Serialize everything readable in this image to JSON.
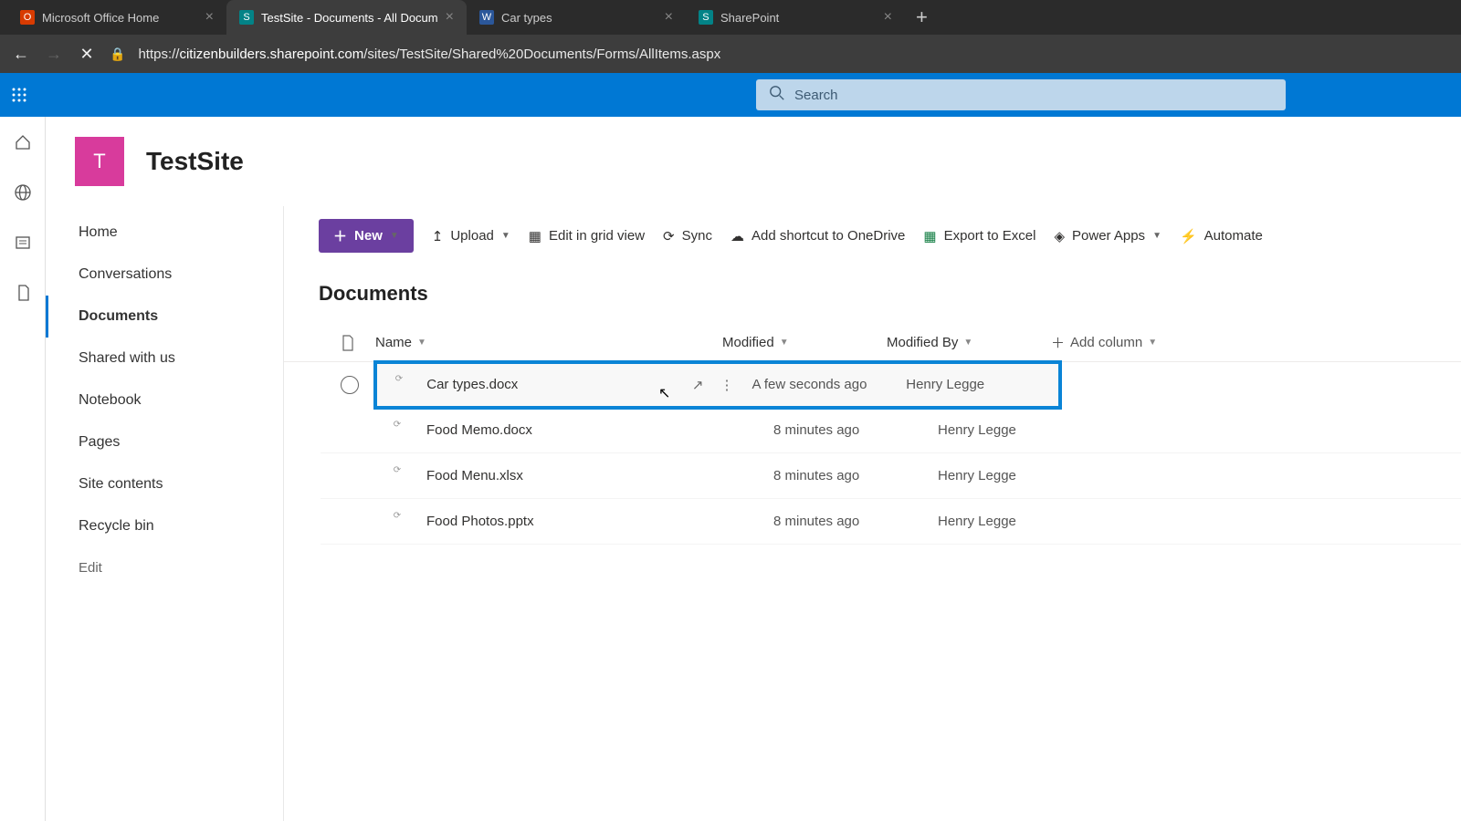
{
  "browser": {
    "tabs": [
      {
        "icon_bg": "#d83b01",
        "icon_text": "O",
        "label": "Microsoft Office Home",
        "active": false
      },
      {
        "icon_bg": "#038387",
        "icon_text": "S",
        "label": "TestSite - Documents - All Docum",
        "active": true
      },
      {
        "icon_bg": "#2b579a",
        "icon_text": "W",
        "label": "Car types",
        "active": false
      },
      {
        "icon_bg": "#038387",
        "icon_text": "S",
        "label": "SharePoint",
        "active": false
      }
    ],
    "url_prefix": "https://",
    "url_host": "citizenbuilders.sharepoint.com",
    "url_path": "/sites/TestSite/Shared%20Documents/Forms/AllItems.aspx"
  },
  "search": {
    "placeholder": "Search"
  },
  "site": {
    "logo_letter": "T",
    "title": "TestSite"
  },
  "left_nav": {
    "items": [
      "Home",
      "Conversations",
      "Documents",
      "Shared with us",
      "Notebook",
      "Pages",
      "Site contents",
      "Recycle bin"
    ],
    "selected_index": 2,
    "edit_label": "Edit"
  },
  "cmd": {
    "new": "New",
    "upload": "Upload",
    "grid": "Edit in grid view",
    "sync": "Sync",
    "shortcut": "Add shortcut to OneDrive",
    "export": "Export to Excel",
    "powerapps": "Power Apps",
    "automate": "Automate"
  },
  "list": {
    "title": "Documents",
    "columns": {
      "name": "Name",
      "modified": "Modified",
      "modified_by": "Modified By",
      "add_column": "Add column"
    },
    "rows": [
      {
        "name": "Car types.docx",
        "modified": "A few seconds ago",
        "by": "Henry Legge",
        "highlight": true
      },
      {
        "name": "Food Memo.docx",
        "modified": "8 minutes ago",
        "by": "Henry Legge",
        "highlight": false
      },
      {
        "name": "Food Menu.xlsx",
        "modified": "8 minutes ago",
        "by": "Henry Legge",
        "highlight": false
      },
      {
        "name": "Food Photos.pptx",
        "modified": "8 minutes ago",
        "by": "Henry Legge",
        "highlight": false
      }
    ]
  }
}
